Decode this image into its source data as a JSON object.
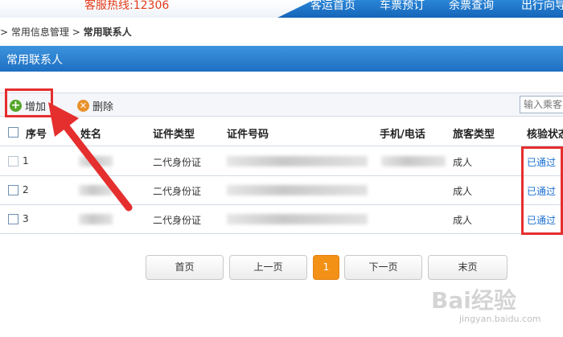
{
  "header": {
    "hotline": "客服热线:12306",
    "nav": [
      "客运首页",
      "车票预订",
      "余票查询",
      "出行向导"
    ]
  },
  "breadcrumb": {
    "prefix": ">",
    "parent": "常用信息管理",
    "separator": ">",
    "current": "常用联系人"
  },
  "section_title": "常用联系人",
  "toolbar": {
    "add_label": "增加",
    "delete_label": "删除",
    "search_placeholder": "输入乘客"
  },
  "table": {
    "headers": {
      "index": "序号",
      "name": "姓名",
      "id_type": "证件类型",
      "id_number": "证件号码",
      "phone": "手机/电话",
      "passenger_type": "旅客类型",
      "status": "核验状态"
    },
    "rows": [
      {
        "index": "1",
        "id_type": "二代身份证",
        "passenger_type": "成人",
        "status": "已通过"
      },
      {
        "index": "2",
        "id_type": "二代身份证",
        "passenger_type": "成人",
        "status": "已通过"
      },
      {
        "index": "3",
        "id_type": "二代身份证",
        "passenger_type": "成人",
        "status": "已通过"
      }
    ]
  },
  "pagination": {
    "first": "首页",
    "prev": "上一页",
    "current": "1",
    "next": "下一页",
    "last": "末页"
  },
  "watermark": {
    "text": "Bai经验",
    "url": "jingyan.baidu.com"
  },
  "colors": {
    "accent_blue": "#1e6fc2",
    "highlight_red": "#e52e2e",
    "page_active": "#f39117",
    "status_link": "#1a6fd1"
  }
}
